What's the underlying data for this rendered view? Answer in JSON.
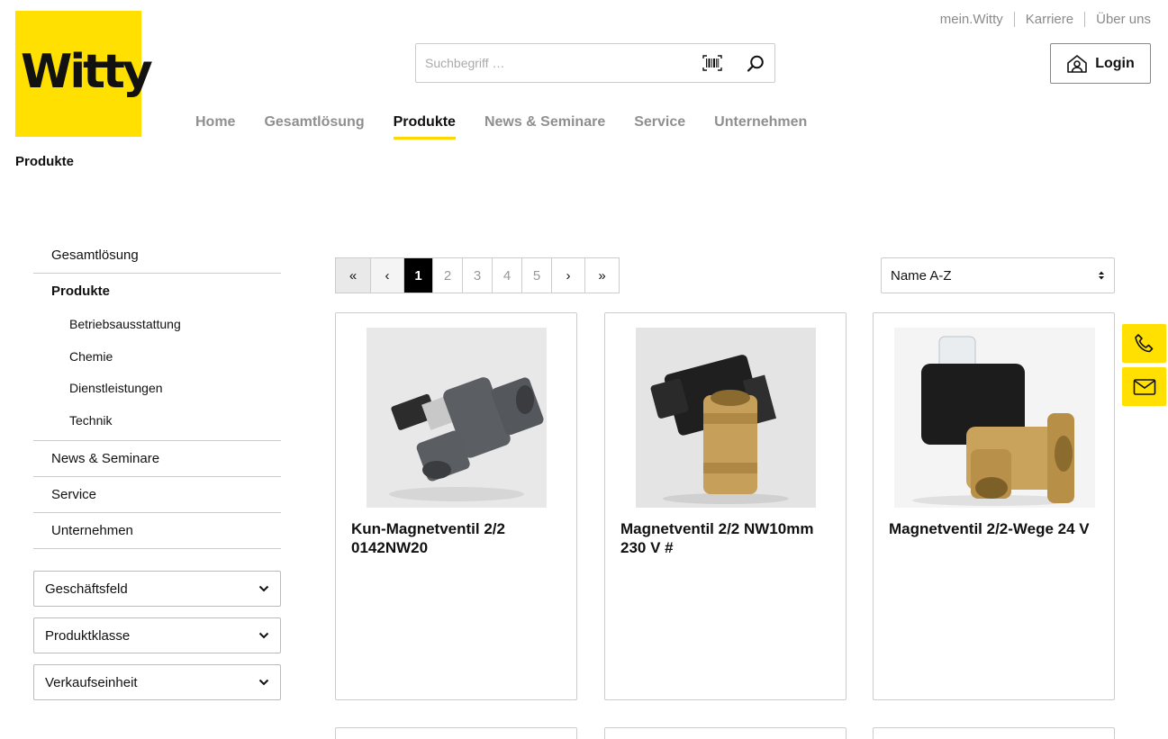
{
  "brand": {
    "logo_text": "Witty",
    "color": "#ffe000"
  },
  "topnav": [
    {
      "label": "mein.Witty"
    },
    {
      "label": "Karriere"
    },
    {
      "label": "Über uns"
    }
  ],
  "search": {
    "placeholder": "Suchbegriff …",
    "value": ""
  },
  "login": {
    "label": "Login"
  },
  "mainnav": [
    {
      "label": "Home"
    },
    {
      "label": "Gesamtlösung"
    },
    {
      "label": "Produkte",
      "active": true
    },
    {
      "label": "News & Seminare"
    },
    {
      "label": "Service"
    },
    {
      "label": "Unternehmen"
    }
  ],
  "breadcrumb": "Produkte",
  "sidebar": {
    "items": [
      {
        "label": "Gesamtlösung"
      },
      {
        "label": "Produkte"
      },
      {
        "label": "News & Seminare"
      },
      {
        "label": "Service"
      },
      {
        "label": "Unternehmen"
      }
    ],
    "subitems": [
      {
        "label": "Betriebsausstattung"
      },
      {
        "label": "Chemie"
      },
      {
        "label": "Dienstleistungen"
      },
      {
        "label": "Technik"
      }
    ]
  },
  "filters": [
    {
      "label": "Geschäftsfeld"
    },
    {
      "label": "Produktklasse"
    },
    {
      "label": "Verkaufseinheit"
    }
  ],
  "pagination": {
    "first": "«",
    "prev": "‹",
    "pages": [
      "1",
      "2",
      "3",
      "4",
      "5"
    ],
    "current": "1",
    "next": "›",
    "last": "»"
  },
  "sort": {
    "selected": "Name A-Z"
  },
  "products": [
    {
      "title": "Kun-Magnetventil 2/2 0142NW20"
    },
    {
      "title": "Magnetventil 2/2 NW10mm 230 V #"
    },
    {
      "title": "Magnetventil 2/2-Wege 24 V"
    }
  ]
}
